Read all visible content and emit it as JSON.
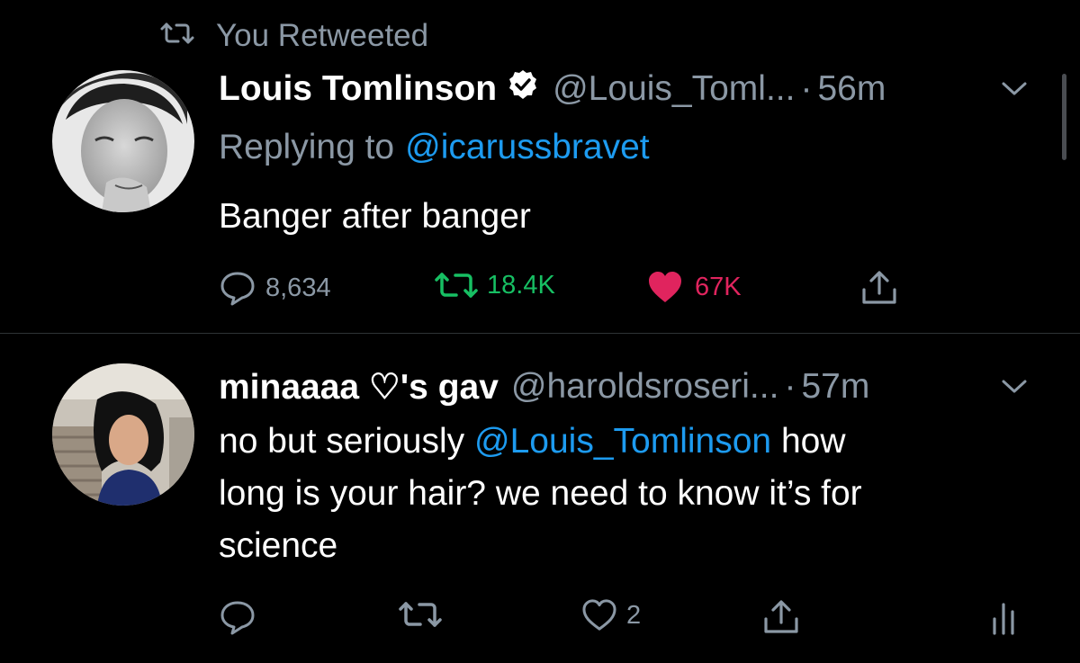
{
  "retweet_header": {
    "label": "You Retweeted"
  },
  "tweets": [
    {
      "name": "Louis Tomlinson",
      "verified": true,
      "handle": "@Louis_Toml...",
      "separator": "·",
      "time": "56m",
      "replying_prefix": "Replying to",
      "replying_to": "@icarussbravet",
      "text": "Banger after banger",
      "actions": {
        "replies": "8,634",
        "retweets": "18.4K",
        "likes": "67K"
      },
      "retweeted": true,
      "liked": true,
      "colors": {
        "retweet_active": "#17bf63",
        "like_active": "#e0245e"
      }
    },
    {
      "name": "minaaaa ♡'s gav",
      "handle": "@haroldsroseri...",
      "separator": "·",
      "time": "57m",
      "text_before": "no but seriously",
      "mention": "@Louis_Tomlinson",
      "text_after_1": "how",
      "text_line2": "long is your hair? we need to know it’s for",
      "text_line3": "science",
      "actions": {
        "likes": "2"
      }
    }
  ],
  "colors": {
    "background": "#000000",
    "secondary_text": "#8b98a5",
    "link": "#1d9bf0",
    "divider": "#2f3336"
  },
  "icons": [
    "retweet-icon",
    "verified-badge-icon",
    "chevron-down-icon",
    "reply-icon",
    "like-icon",
    "share-icon",
    "analytics-icon"
  ]
}
